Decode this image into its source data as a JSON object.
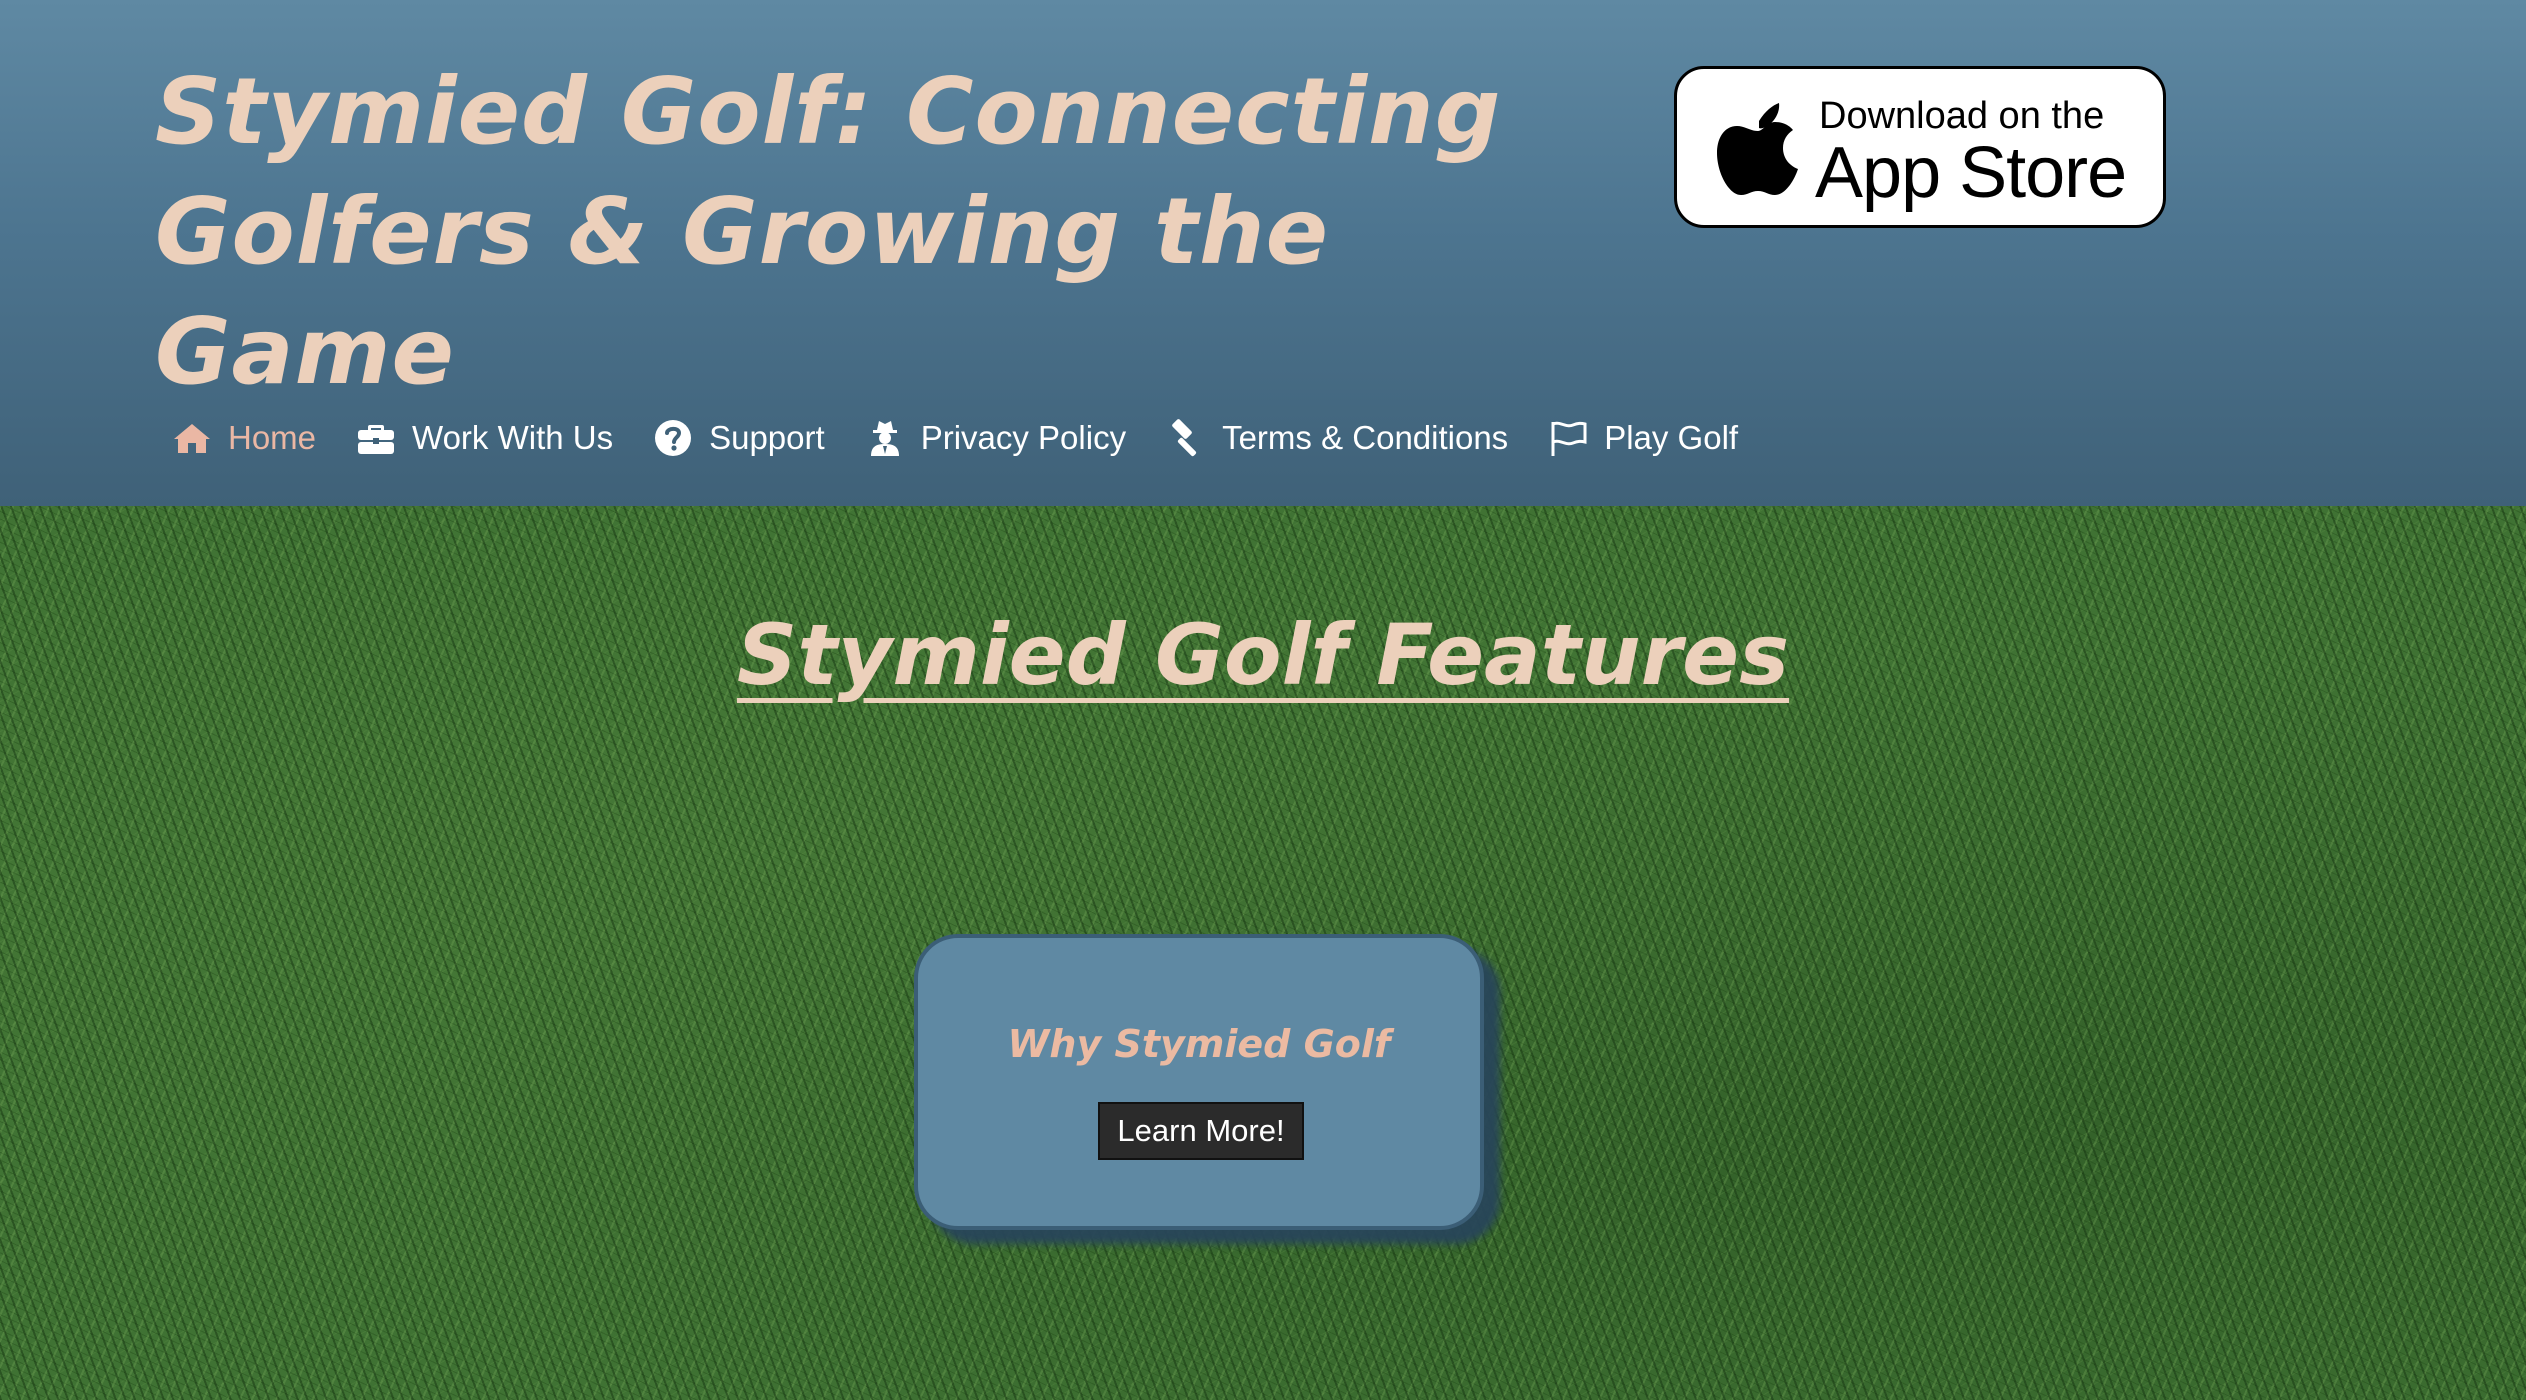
{
  "header": {
    "title_line1": "Stymied Golf: Connecting",
    "title_line2": "Golfers & Growing the Game"
  },
  "app_store_badge": {
    "small_text": "Download on the",
    "big_text": "App Store",
    "icon": "apple-logo-icon"
  },
  "nav": {
    "items": [
      {
        "label": "Home",
        "icon": "home-icon",
        "active": true
      },
      {
        "label": "Work With Us",
        "icon": "briefcase-icon",
        "active": false
      },
      {
        "label": "Support",
        "icon": "question-circle-icon",
        "active": false
      },
      {
        "label": "Privacy Policy",
        "icon": "user-secret-icon",
        "active": false
      },
      {
        "label": "Terms & Conditions",
        "icon": "gavel-icon",
        "active": false
      },
      {
        "label": "Play Golf",
        "icon": "flag-icon",
        "active": false
      }
    ]
  },
  "main": {
    "features_title": "Stymied Golf Features",
    "card": {
      "title": "Why Stymied Golf",
      "button_label": "Learn More!"
    }
  },
  "colors": {
    "header_top": "#5f89a3",
    "header_bottom": "#3f6178",
    "title_color": "#ecd0bb",
    "active_nav": "#eab7a4",
    "card_bg": "#5f89a3",
    "button_bg": "#2b2b2b"
  }
}
